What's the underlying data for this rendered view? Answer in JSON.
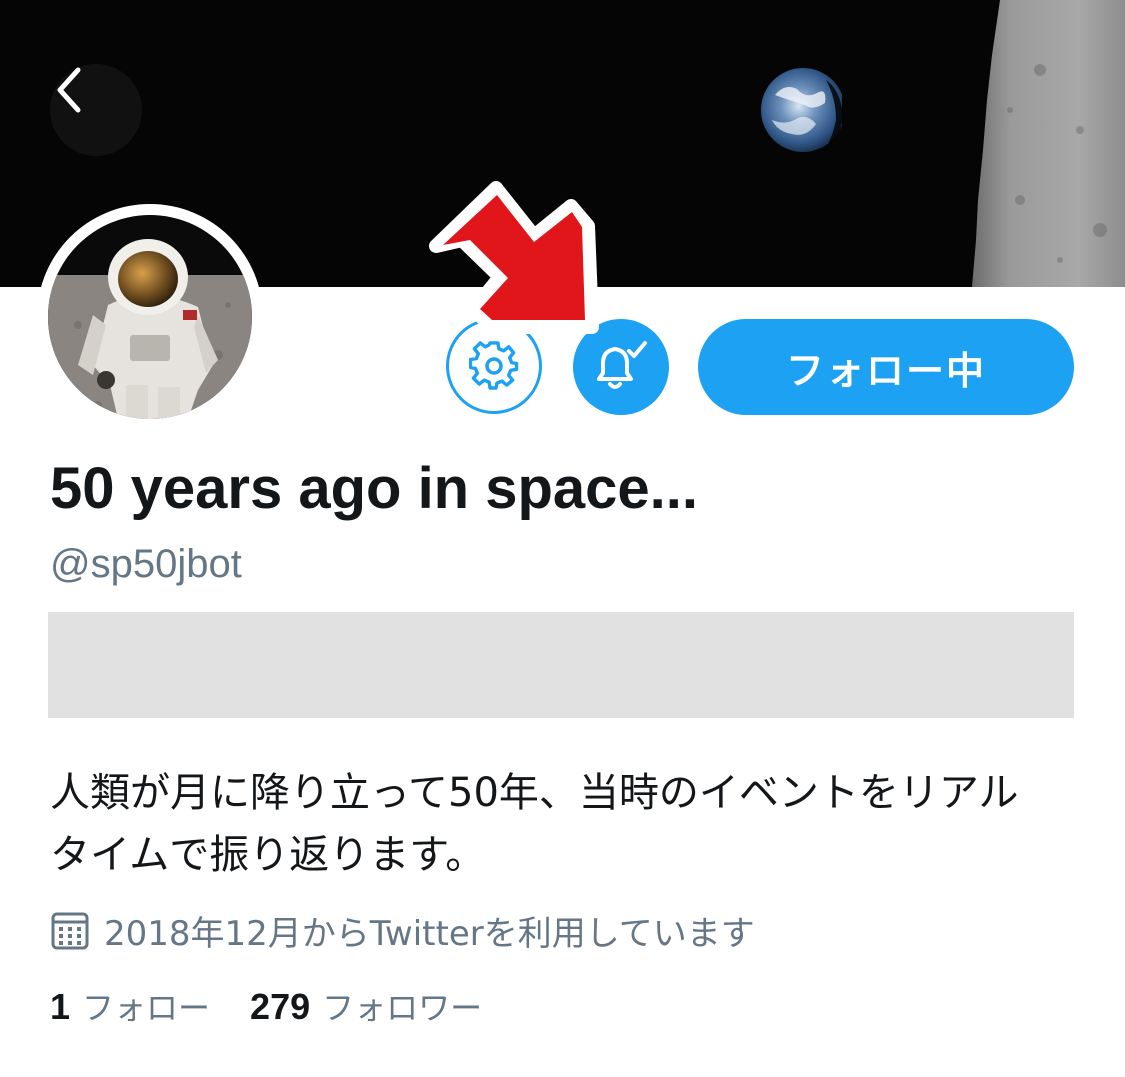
{
  "profile": {
    "display_name": "50 years ago in space...",
    "handle": "@sp50jbot",
    "bio_lines": [
      "人類が月に降り立って50年、当時のイベントをリアル",
      "タイムで振り返ります。"
    ],
    "joined": "2018年12月からTwitterを利用しています"
  },
  "actions": {
    "follow_label": "フォロー中"
  },
  "stats": {
    "following_count": "1",
    "following_label": "フォロー",
    "followers_count": "279",
    "followers_label": "フォロワー"
  },
  "icons": {
    "back": "chevron-left-icon",
    "settings": "gear-icon",
    "notifications": "bell-check-icon",
    "joined": "calendar-icon"
  },
  "colors": {
    "accent": "#1da1f2",
    "text_primary": "#14171a",
    "text_secondary": "#657786",
    "annotation_arrow": "#e0161b"
  }
}
